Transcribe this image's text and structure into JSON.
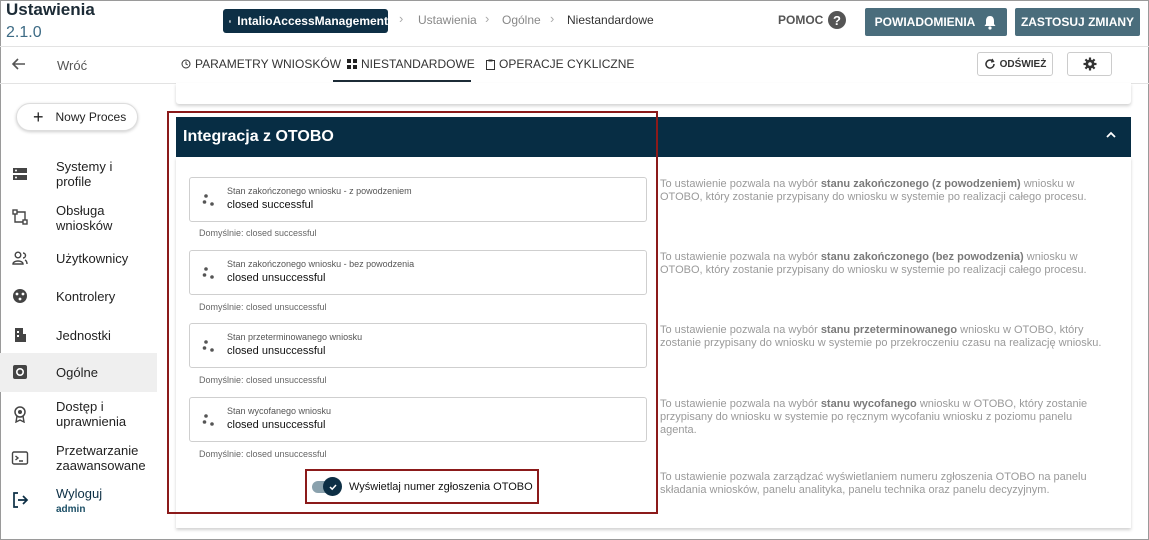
{
  "header": {
    "title": "Ustawienia",
    "version": "2.1.0",
    "app_name": "IntalioAccessManagement",
    "breadcrumbs": [
      "Ustawienia",
      "Ogólne",
      "Niestandardowe"
    ],
    "help_label": "POMOC",
    "notifications_label": "POWIADOMIENIA",
    "apply_label": "ZASTOSUJ ZMIANY"
  },
  "toolbar": {
    "back_label": "Wróć",
    "tabs": [
      {
        "label": "PARAMETRY WNIOSKÓW",
        "icon": "clock-icon"
      },
      {
        "label": "NIESTANDARDOWE",
        "icon": "grid-icon",
        "active": true
      },
      {
        "label": "OPERACJE CYKLICZNE",
        "icon": "clipboard-icon"
      }
    ],
    "refresh_label": "ODŚWIEŻ"
  },
  "sidebar": {
    "new_process_label": "Nowy Proces",
    "items": [
      {
        "label_line1": "Systemy i",
        "label_line2": "profile",
        "icon": "server-icon"
      },
      {
        "label_line1": "Obsługa",
        "label_line2": "wniosków",
        "icon": "workflow-icon"
      },
      {
        "label_line1": "Użytkownicy",
        "label_line2": "",
        "icon": "users-icon"
      },
      {
        "label_line1": "Kontrolery",
        "label_line2": "",
        "icon": "controllers-icon"
      },
      {
        "label_line1": "Jednostki",
        "label_line2": "",
        "icon": "building-icon"
      },
      {
        "label_line1": "Ogólne",
        "label_line2": "",
        "icon": "settings-box-icon",
        "active": true
      },
      {
        "label_line1": "Dostęp i",
        "label_line2": "uprawnienia",
        "icon": "badge-icon"
      },
      {
        "label_line1": "Przetwarzanie",
        "label_line2": "zaawansowane",
        "icon": "terminal-icon"
      }
    ],
    "logout_label": "Wyloguj",
    "user": "admin"
  },
  "section": {
    "title": "Integracja z OTOBO",
    "fields": [
      {
        "label": "Stan zakończonego wniosku - z powodzeniem",
        "value": "closed successful",
        "default": "Domyślnie: closed successful",
        "desc_pre": "To ustawienie pozwala na wybór ",
        "desc_bold": "stanu zakończonego (z powodzeniem)",
        "desc_post": " wniosku w OTOBO, który zostanie przypisany do wniosku w systemie po realizacji całego procesu."
      },
      {
        "label": "Stan zakończonego wniosku - bez powodzenia",
        "value": "closed unsuccessful",
        "default": "Domyślnie: closed unsuccessful",
        "desc_pre": "To ustawienie pozwala na wybór ",
        "desc_bold": "stanu zakończonego (bez powodzenia)",
        "desc_post": " wniosku w OTOBO, który zostanie przypisany do wniosku w systemie po realizacji całego procesu."
      },
      {
        "label": "Stan przeterminowanego wniosku",
        "value": "closed unsuccessful",
        "default": "Domyślnie: closed unsuccessful",
        "desc_pre": "To ustawienie pozwala na wybór ",
        "desc_bold": "stanu przeterminowanego",
        "desc_post": " wniosku w OTOBO, który zostanie przypisany do wniosku w systemie po przekroczeniu czasu na realizację wniosku."
      },
      {
        "label": "Stan wycofanego wniosku",
        "value": "closed unsuccessful",
        "default": "Domyślnie: closed unsuccessful",
        "desc_pre": "To ustawienie pozwala na wybór ",
        "desc_bold": "stanu wycofanego",
        "desc_post": " wniosku w OTOBO, który zostanie przypisany do wniosku w systemie po ręcznym wycofaniu wniosku z poziomu panelu agenta."
      }
    ],
    "toggle": {
      "label": "Wyświetlaj numer zgłoszenia OTOBO",
      "checked": true,
      "desc": "To ustawienie pozwala zarządzać wyświetlaniem numeru zgłoszenia OTOBO na panelu składania wniosków, panelu analityka, panelu technika oraz panelu decyzyjnym."
    }
  },
  "colors": {
    "header_bg": "#072d44",
    "accent_button": "#4a6d7c",
    "highlight": "#8b1a1a"
  }
}
